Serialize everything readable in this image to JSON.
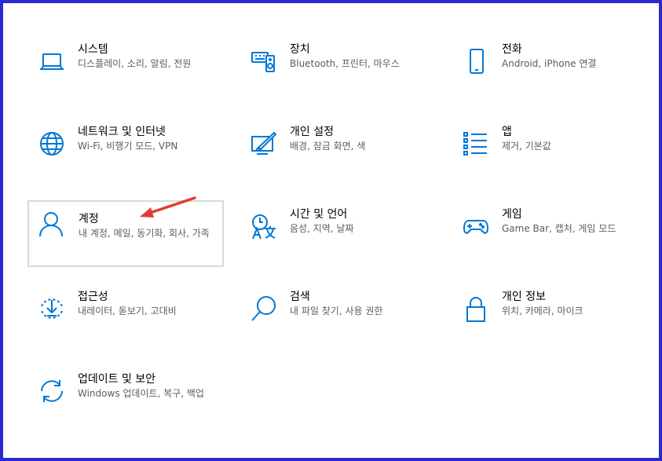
{
  "accent_color": "#0078d7",
  "frame_color": "#2a2ad0",
  "annotation_color": "#e03c31",
  "tiles": [
    {
      "title": "시스템",
      "desc": "디스플레이, 소리, 알림, 전원",
      "icon": "laptop-icon"
    },
    {
      "title": "장치",
      "desc": "Bluetooth, 프린터, 마우스",
      "icon": "keyboard-speaker-icon"
    },
    {
      "title": "전화",
      "desc": "Android, iPhone 연결",
      "icon": "phone-icon"
    },
    {
      "title": "네트워크 및 인터넷",
      "desc": "Wi-Fi, 비행기 모드, VPN",
      "icon": "globe-icon"
    },
    {
      "title": "개인 설정",
      "desc": "배경, 잠금 화면, 색",
      "icon": "personalization-icon"
    },
    {
      "title": "앱",
      "desc": "제거, 기본값",
      "icon": "apps-list-icon"
    },
    {
      "title": "계정",
      "desc": "내 계정, 메일, 동기화, 회사, 가족",
      "icon": "person-icon"
    },
    {
      "title": "시간 및 언어",
      "desc": "음성, 지역, 날짜",
      "icon": "time-language-icon"
    },
    {
      "title": "게임",
      "desc": "Game Bar, 캡처, 게임 모드",
      "icon": "gamepad-icon"
    },
    {
      "title": "접근성",
      "desc": "내레이터, 돋보기, 고대비",
      "icon": "ease-of-access-icon"
    },
    {
      "title": "검색",
      "desc": "내 파일 찾기, 사용 권한",
      "icon": "search-icon"
    },
    {
      "title": "개인 정보",
      "desc": "위치, 카메라, 마이크",
      "icon": "lock-icon"
    },
    {
      "title": "업데이트 및 보안",
      "desc": "Windows 업데이트, 복구, 백업",
      "icon": "sync-icon"
    }
  ],
  "selected_tile": "계정"
}
